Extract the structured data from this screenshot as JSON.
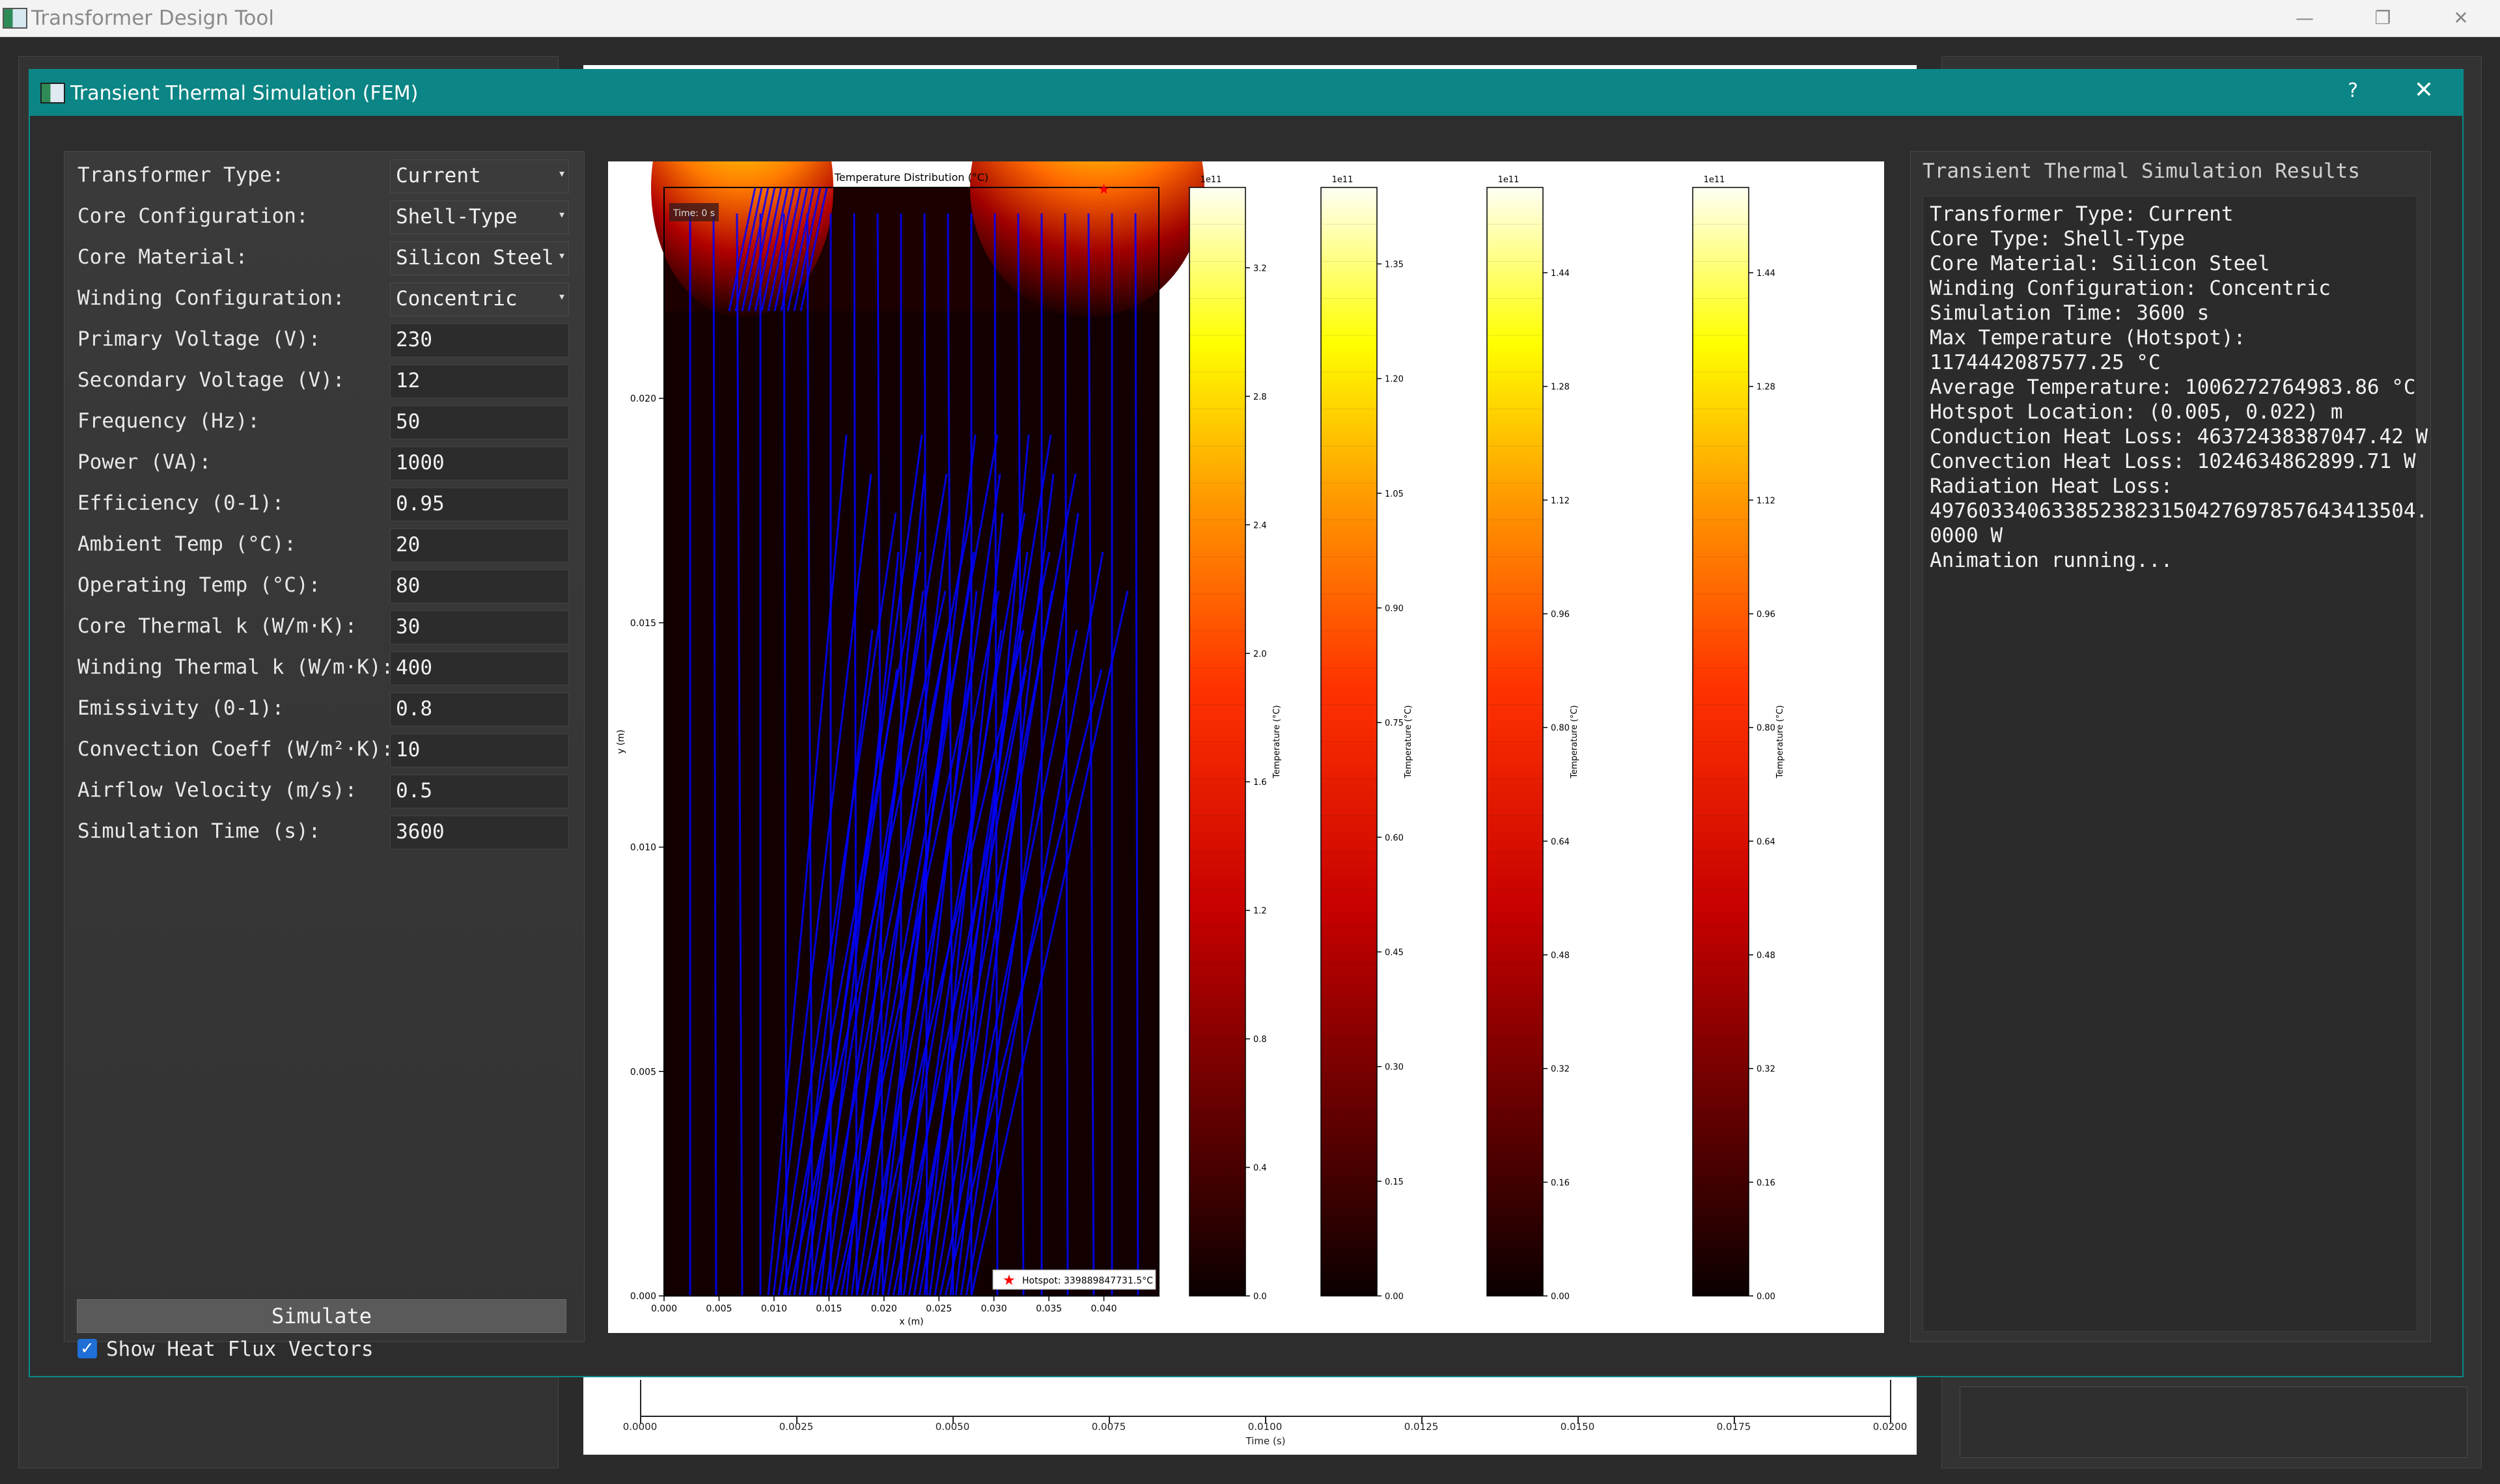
{
  "app": {
    "title": "Transformer Design Tool",
    "controls": {
      "minimize": "—",
      "maximize": "❐",
      "close": "✕"
    }
  },
  "background_plot": {
    "xlabel": "Time (s)",
    "ticks": [
      "0.0000",
      "0.0025",
      "0.0050",
      "0.0075",
      "0.0100",
      "0.0125",
      "0.0150",
      "0.0175",
      "0.0200"
    ]
  },
  "dialog": {
    "title": "Transient Thermal Simulation (FEM)",
    "help": "?",
    "close": "✕"
  },
  "form": {
    "fields": [
      {
        "label": "Transformer Type:",
        "value": "Current",
        "kind": "select"
      },
      {
        "label": "Core Configuration:",
        "value": "Shell-Type",
        "kind": "select"
      },
      {
        "label": "Core Material:",
        "value": "Silicon Steel",
        "kind": "select"
      },
      {
        "label": "Winding Configuration:",
        "value": "Concentric",
        "kind": "select"
      },
      {
        "label": "Primary Voltage (V):",
        "value": "230",
        "kind": "input"
      },
      {
        "label": "Secondary Voltage (V):",
        "value": "12",
        "kind": "input"
      },
      {
        "label": "Frequency (Hz):",
        "value": "50",
        "kind": "input"
      },
      {
        "label": "Power (VA):",
        "value": "1000",
        "kind": "input"
      },
      {
        "label": "Efficiency (0-1):",
        "value": "0.95",
        "kind": "input"
      },
      {
        "label": "Ambient Temp (°C):",
        "value": "20",
        "kind": "input"
      },
      {
        "label": "Operating Temp (°C):",
        "value": "80",
        "kind": "input"
      },
      {
        "label": "Core Thermal k (W/m·K):",
        "value": "30",
        "kind": "input"
      },
      {
        "label": "Winding Thermal k (W/m·K):",
        "value": "400",
        "kind": "input"
      },
      {
        "label": "Emissivity (0-1):",
        "value": "0.8",
        "kind": "input"
      },
      {
        "label": "Convection Coeff (W/m²·K):",
        "value": "10",
        "kind": "input"
      },
      {
        "label": "Airflow Velocity (m/s):",
        "value": "0.5",
        "kind": "input"
      },
      {
        "label": "Simulation Time (s):",
        "value": "3600",
        "kind": "input"
      }
    ],
    "checkbox_label": "Show Heat Flux Vectors",
    "checkbox_checked": true,
    "simulate_label": "Simulate"
  },
  "chart_data": {
    "type": "heatmap",
    "title": "Temperature Distribution (°C)",
    "xlabel": "x (m)",
    "ylabel": "y (m)",
    "xlim": [
      0,
      0.045
    ],
    "ylim": [
      0,
      0.0247
    ],
    "xticks": [
      "0.000",
      "0.005",
      "0.010",
      "0.015",
      "0.020",
      "0.025",
      "0.030",
      "0.035",
      "0.040"
    ],
    "yticks": [
      "0.000",
      "0.005",
      "0.010",
      "0.015",
      "0.020"
    ],
    "time_label": "Time: 0 s",
    "hotspot_legend": "Hotspot: 339889847731.5°C",
    "colormap": "hot",
    "colorbars": [
      {
        "multiplier": "1e11",
        "label": "Temperature (°C)",
        "max": 3.45,
        "ticks": [
          "0.0",
          "0.4",
          "0.8",
          "1.2",
          "1.6",
          "2.0",
          "2.4",
          "2.8",
          "3.2"
        ]
      },
      {
        "multiplier": "1e11",
        "label": "Temperature (°C)",
        "max": 1.45,
        "ticks": [
          "0.00",
          "0.15",
          "0.30",
          "0.45",
          "0.60",
          "0.75",
          "0.90",
          "1.05",
          "1.20",
          "1.35"
        ]
      },
      {
        "multiplier": "1e11",
        "label": "Temperature (°C)",
        "max": 1.56,
        "ticks": [
          "0.00",
          "0.16",
          "0.32",
          "0.48",
          "0.64",
          "0.80",
          "0.96",
          "1.12",
          "1.28",
          "1.44"
        ]
      },
      {
        "multiplier": "1e11",
        "label": "Temperature (°C)",
        "max": 1.56,
        "ticks": [
          "0.00",
          "0.16",
          "0.32",
          "0.48",
          "0.64",
          "0.80",
          "0.96",
          "1.12",
          "1.28",
          "1.44"
        ]
      }
    ],
    "colors": {
      "flux_vectors": "#0000ff",
      "hotspot_marker": "#ff0000"
    }
  },
  "results": {
    "title": "Transient Thermal Simulation Results",
    "lines": [
      "Transformer Type: Current",
      "Core Type: Shell-Type",
      "Core Material: Silicon Steel",
      "Winding Configuration: Concentric",
      "Simulation Time: 3600 s",
      "Max Temperature (Hotspot):",
      "1174442087577.25 °C",
      "Average Temperature: 1006272764983.86 °C",
      "Hotspot Location: (0.005, 0.022) m",
      "Conduction Heat Loss: 46372438387047.42 W",
      "Convection Heat Loss: 1024634862899.71 W",
      "Radiation Heat Loss:",
      "4976033406338523823150427697857643413504.",
      "0000 W",
      "Animation running..."
    ]
  }
}
